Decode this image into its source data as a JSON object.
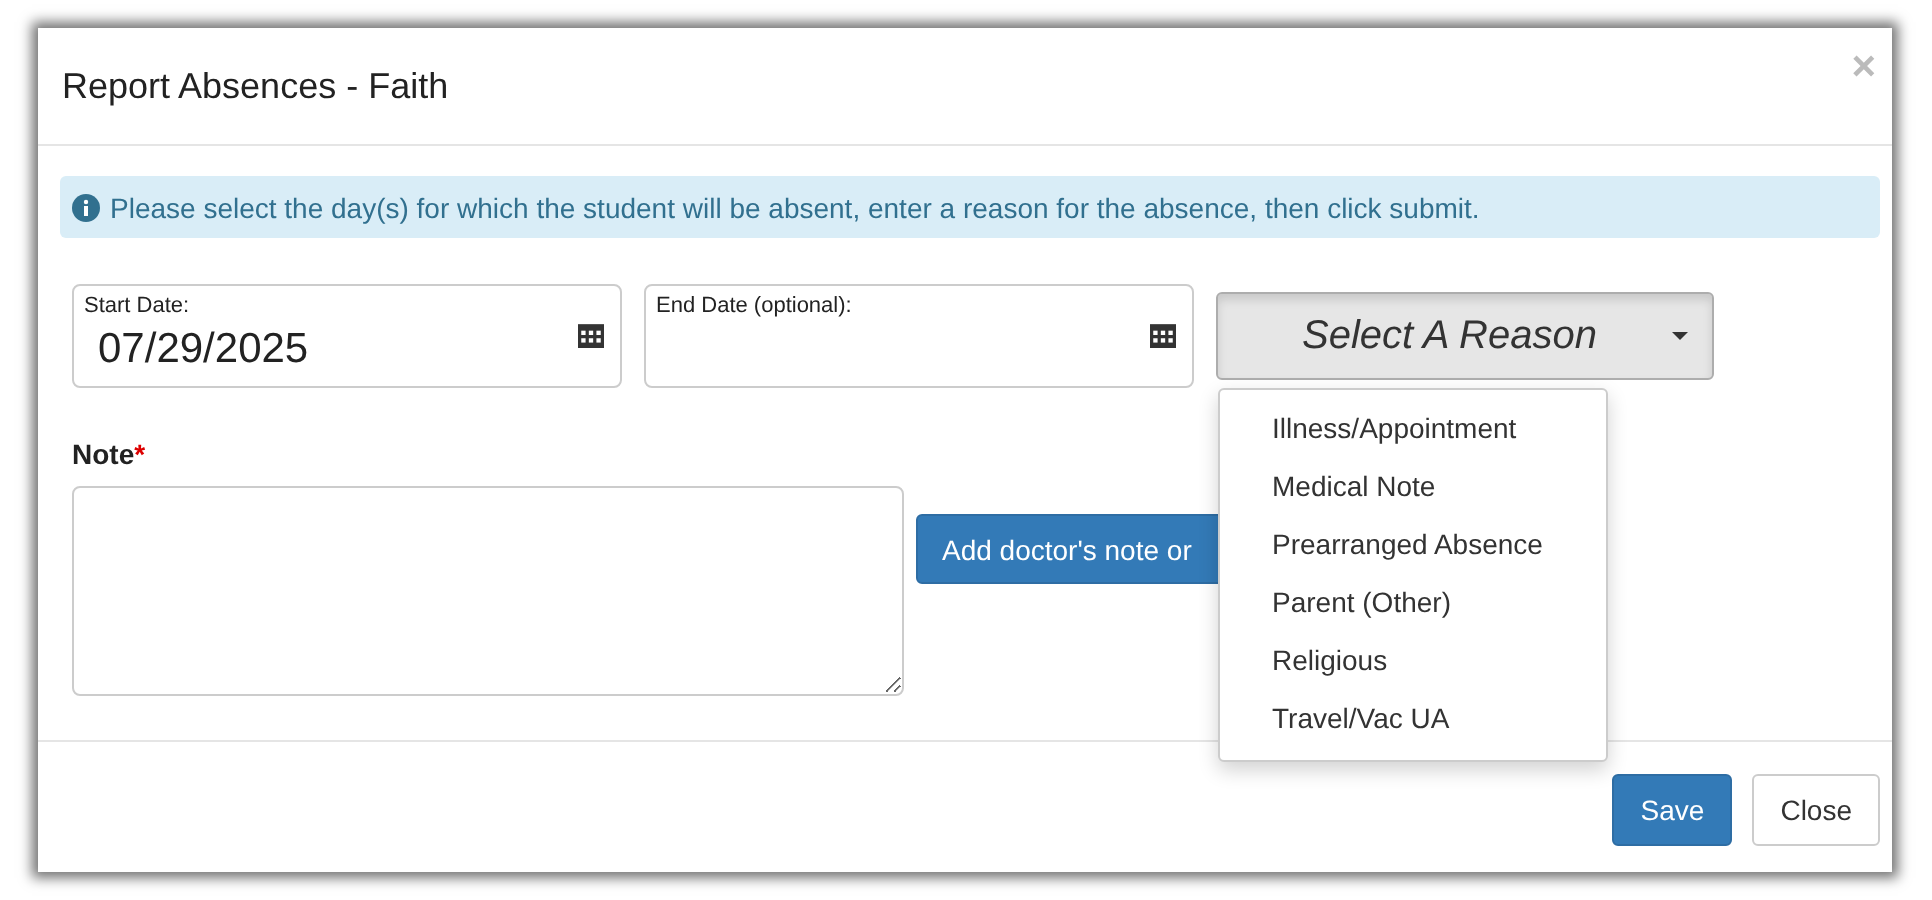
{
  "dialog": {
    "title": "Report Absences - Faith",
    "close_icon": "×"
  },
  "alert": {
    "text": "Please select the day(s) for which the student will be absent, enter a reason for the absence, then click submit."
  },
  "start_date": {
    "label": "Start Date:",
    "value": "07/29/2025"
  },
  "end_date": {
    "label": "End Date (optional):"
  },
  "reason_select": {
    "label": "Select A Reason",
    "expanded": true,
    "options": [
      "Illness/Appointment",
      "Medical Note",
      "Prearranged Absence",
      "Parent (Other)",
      "Religious",
      "Travel/Vac UA"
    ]
  },
  "note": {
    "label": "Note",
    "required_mark": "*"
  },
  "attach_button": "Add doctor's note or",
  "buttons": [
    {
      "label": "Save",
      "kind": "primary"
    },
    {
      "label": "Close",
      "kind": "default"
    }
  ]
}
